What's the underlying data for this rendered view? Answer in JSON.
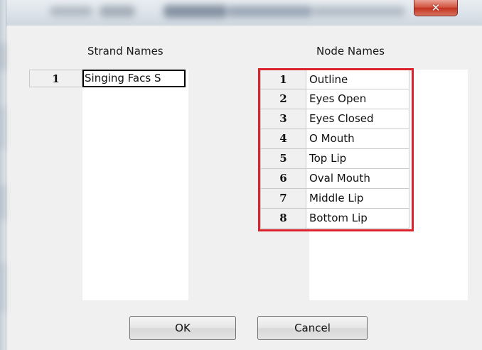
{
  "window": {
    "close_glyph": "✕"
  },
  "strand_panel": {
    "header": "Strand Names",
    "rows": [
      {
        "num": "1",
        "name": "Singing Facs S"
      }
    ]
  },
  "node_panel": {
    "header": "Node Names",
    "rows": [
      {
        "num": "1",
        "name": "Outline"
      },
      {
        "num": "2",
        "name": "Eyes Open"
      },
      {
        "num": "3",
        "name": "Eyes Closed"
      },
      {
        "num": "4",
        "name": "O Mouth"
      },
      {
        "num": "5",
        "name": "Top Lip"
      },
      {
        "num": "6",
        "name": "Oval Mouth"
      },
      {
        "num": "7",
        "name": "Middle Lip"
      },
      {
        "num": "8",
        "name": "Bottom Lip"
      }
    ],
    "highlight_color": "#d9232d"
  },
  "buttons": {
    "ok": "OK",
    "cancel": "Cancel"
  }
}
